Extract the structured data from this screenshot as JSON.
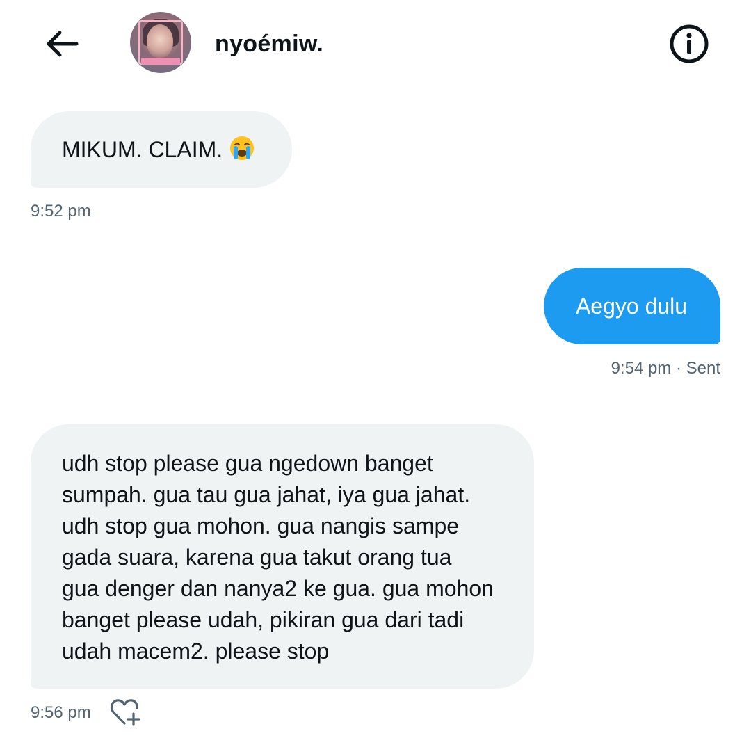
{
  "header": {
    "username": "nyoémiw.",
    "back_icon": "back-arrow-icon",
    "info_icon": "info-icon",
    "avatar": "profile-avatar"
  },
  "messages": [
    {
      "direction": "incoming",
      "text": "MIKUM. CLAIM.",
      "emoji": "loudly-crying-face-emoji",
      "time": "9:52 pm"
    },
    {
      "direction": "outgoing",
      "text": "Aegyo dulu",
      "time": "9:54 pm · Sent"
    },
    {
      "direction": "incoming",
      "lines": [
        "udh stop please gua ngedown banget",
        "sumpah. gua tau gua jahat, iya gua jahat.",
        "udh stop gua mohon. gua nangis sampe",
        "gada suara, karena gua takut orang tua",
        "gua denger dan nanya2 ke gua. gua mohon",
        "banget please udah, pikiran gua dari tadi",
        "udah macem2. please stop"
      ],
      "time": "9:56 pm",
      "reaction_icon": "add-reaction-heart-icon"
    }
  ],
  "colors": {
    "incoming_bubble": "#eff3f4",
    "outgoing_bubble": "#1d9bf0",
    "timestamp": "#536471",
    "text": "#0f1419"
  }
}
